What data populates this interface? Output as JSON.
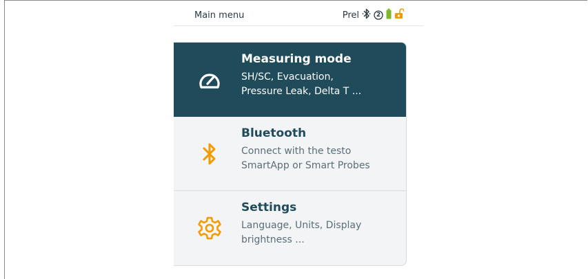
{
  "status_bar": {
    "title": "Main menu",
    "prel_label": "Prel",
    "icons": [
      "bluetooth-icon",
      "probe-count-icon",
      "battery-icon",
      "lock-icon"
    ],
    "probe_count": "2"
  },
  "menu": {
    "items": [
      {
        "title": "Measuring mode",
        "description": "SH/SC, Evacuation,\nPressure Leak, Delta T ...",
        "icon": "gauge-icon",
        "active": true
      },
      {
        "title": "Bluetooth",
        "description": "Connect with the testo\nSmartApp or Smart Probes",
        "icon": "bluetooth-icon",
        "active": false
      },
      {
        "title": "Settings",
        "description": "Language, Units, Display\nbrightness ...",
        "icon": "gear-icon",
        "active": false
      }
    ]
  },
  "colors": {
    "active_bg": "#1f4b5b",
    "accent": "#f39a00",
    "text_dark": "#1f4b5b",
    "battery_green": "#7bb82a"
  }
}
